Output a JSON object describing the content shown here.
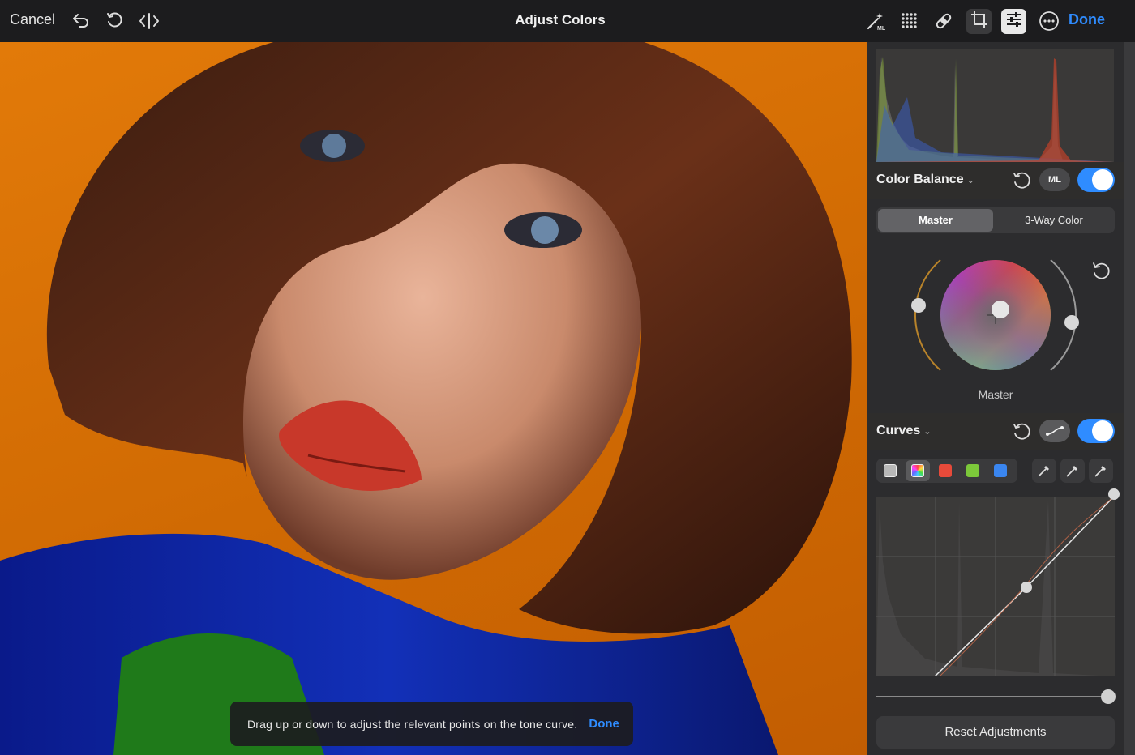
{
  "toolbar": {
    "cancel_label": "Cancel",
    "title": "Adjust Colors",
    "done_label": "Done"
  },
  "tooltip": {
    "text": "Drag up or down to adjust the relevant points on the tone curve.",
    "done_label": "Done"
  },
  "color_balance": {
    "title": "Color Balance",
    "ml_label": "ML",
    "enabled": true,
    "tabs": [
      "Master",
      "3-Way Color"
    ],
    "active_tab": "Master",
    "wheel_label": "Master"
  },
  "curves": {
    "title": "Curves",
    "enabled": true,
    "channels": [
      "luminance",
      "rgb",
      "red",
      "green",
      "blue"
    ],
    "active_channel": "rgb"
  },
  "reset_label": "Reset Adjustments",
  "colors": {
    "accent": "#2f8cff",
    "panel": "#2c2c2e"
  }
}
